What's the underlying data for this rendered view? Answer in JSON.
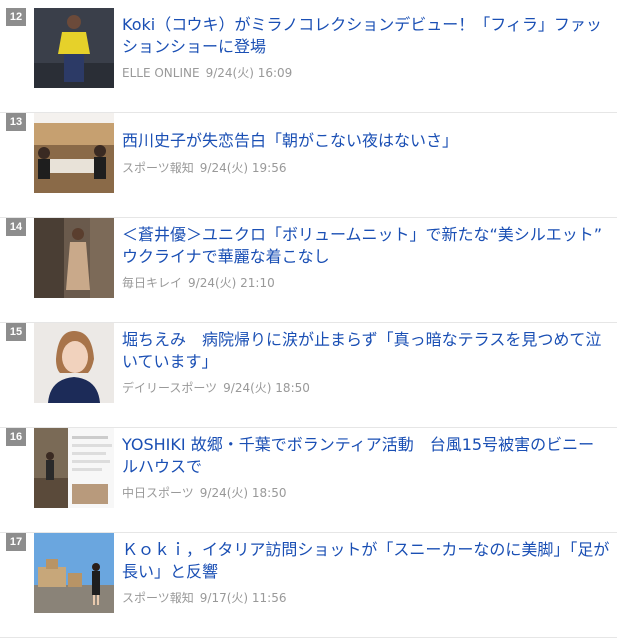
{
  "articles": [
    {
      "rank": "12",
      "title": "Koki（コウキ）がミラノコレクションデビュー！「フィラ」ファッションショーに登場",
      "source": "ELLE ONLINE",
      "time": "9/24(火) 16:09"
    },
    {
      "rank": "13",
      "title": "西川史子が失恋告白「朝がこない夜はないさ」",
      "source": "スポーツ報知",
      "time": "9/24(火) 19:56"
    },
    {
      "rank": "14",
      "title": "＜蒼井優＞ユニクロ「ボリュームニット」で新たな“美シルエット”　ウクライナで華麗な着こなし",
      "source": "毎日キレイ",
      "time": "9/24(火) 21:10"
    },
    {
      "rank": "15",
      "title": "堀ちえみ　病院帰りに涙が止まらず「真っ暗なテラスを見つめて泣いています」",
      "source": "デイリースポーツ",
      "time": "9/24(火) 18:50"
    },
    {
      "rank": "16",
      "title": "YOSHIKI 故郷・千葉でボランティア活動　台風15号被害のビニールハウスで",
      "source": "中日スポーツ",
      "time": "9/24(火) 18:50"
    },
    {
      "rank": "17",
      "title": "Ｋｏｋｉ，イタリア訪問ショットが「スニーカーなのに美脚」「足が長い」と反響",
      "source": "スポーツ報知",
      "time": "9/17(火) 11:56"
    }
  ]
}
